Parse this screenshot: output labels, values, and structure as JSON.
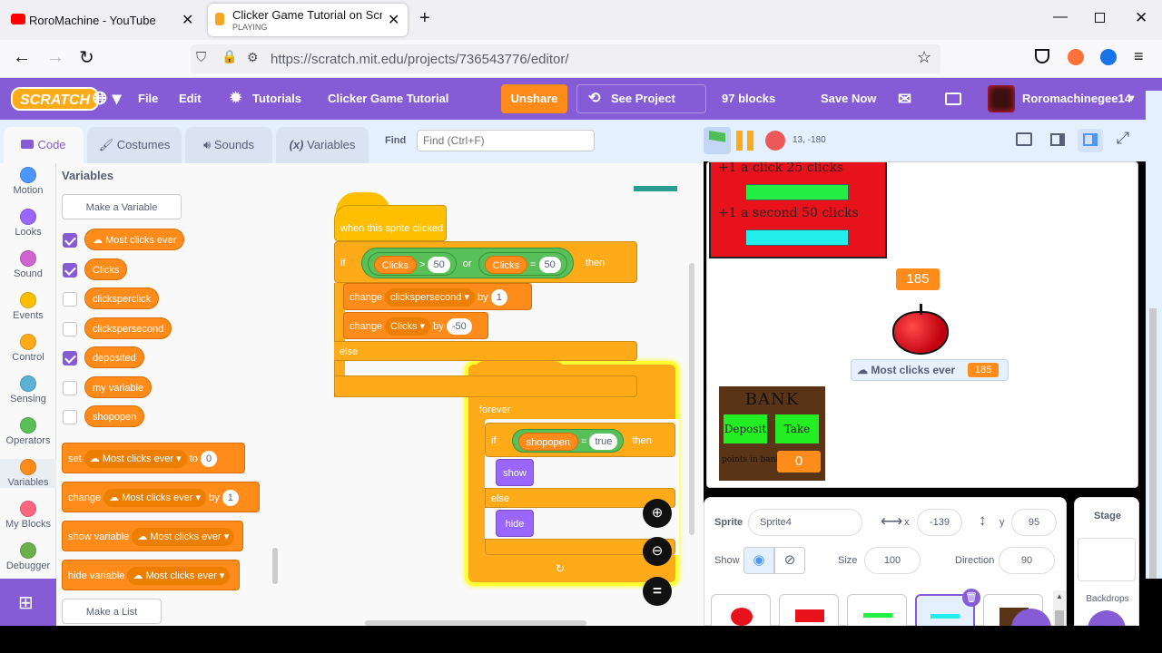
{
  "browser": {
    "tab1_title": "RoroMachine - YouTube",
    "tab2_title": "Clicker Game Tutorial on Scratc",
    "tab2_status": "PLAYING",
    "url": "https://scratch.mit.edu/projects/736543776/editor/"
  },
  "menu": {
    "file": "File",
    "edit": "Edit",
    "tutorials": "Tutorials",
    "project_title": "Clicker Game Tutorial",
    "unshare": "Unshare",
    "see_project": "See Project Page",
    "block_count": "97 blocks",
    "save_now": "Save Now",
    "username": "Roromachinegee14",
    "logo": "SCRATCH"
  },
  "tabs": {
    "code": "Code",
    "costumes": "Costumes",
    "sounds": "Sounds",
    "variables": "Variables",
    "find": "Find",
    "find_placeholder": "Find (Ctrl+F)"
  },
  "categories": [
    {
      "label": "Motion",
      "color": "#4c97ff"
    },
    {
      "label": "Looks",
      "color": "#9966ff"
    },
    {
      "label": "Sound",
      "color": "#cf63cf"
    },
    {
      "label": "Events",
      "color": "#ffbf00"
    },
    {
      "label": "Control",
      "color": "#ffab19"
    },
    {
      "label": "Sensing",
      "color": "#5cb1d6"
    },
    {
      "label": "Operators",
      "color": "#59c059"
    },
    {
      "label": "Variables",
      "color": "#ff8c1a"
    },
    {
      "label": "My Blocks",
      "color": "#ff6680"
    },
    {
      "label": "Debugger",
      "color": "#6ab04c"
    }
  ],
  "palette": {
    "heading": "Variables",
    "make_variable": "Make a Variable",
    "variables": [
      {
        "name": "Most clicks ever",
        "checked": true
      },
      {
        "name": "Clicks",
        "checked": true
      },
      {
        "name": "clicksperclick",
        "checked": false
      },
      {
        "name": "clickspersecond",
        "checked": false
      },
      {
        "name": "deposited",
        "checked": true
      },
      {
        "name": "my variable",
        "checked": false
      },
      {
        "name": "shopopen",
        "checked": false
      }
    ],
    "set_label": "set",
    "set_var": "Most clicks ever",
    "set_to": "to",
    "set_value": "0",
    "change_label": "change",
    "change_var": "Most clicks ever",
    "change_by": "by",
    "change_value": "1",
    "show_label": "show variable",
    "show_var": "Most clicks ever",
    "hide_label": "hide variable",
    "hide_var": "Most clicks ever",
    "make_list": "Make a List"
  },
  "script1": {
    "hat": "when this sprite clicked",
    "if": "if",
    "clicks1": "Clicks",
    "gt": ">",
    "v50a": "50",
    "or": "or",
    "clicks2": "Clicks",
    "eq": "=",
    "v50b": "50",
    "then": "then",
    "change1": "change",
    "change1_var": "clickspersecond",
    "by1": "by",
    "change1_val": "1",
    "change2": "change",
    "change2_var": "Clicks",
    "by2": "by",
    "change2_val": "-50",
    "else": "else"
  },
  "script2": {
    "forever": "forever",
    "if": "if",
    "var": "shopopen",
    "eq": "=",
    "val": "true",
    "then": "then",
    "show": "show",
    "else": "else",
    "hide": "hide"
  },
  "stage_header": {
    "coords": "13, -180"
  },
  "stage": {
    "shop_line1": "+1 a click  25 clicks",
    "shop_line2": "+1 a second 50 clicks",
    "clicks_value": "185",
    "monitor_label": "Most clicks ever",
    "monitor_value": "185",
    "bank_title": "BANK",
    "deposit": "Deposit",
    "take": "Take",
    "points_label": "points in bank",
    "bank_value": "0"
  },
  "sprite_info": {
    "sprite_label": "Sprite",
    "sprite_name": "Sprite4",
    "x_label": "x",
    "x": "-139",
    "y_label": "y",
    "y": "95",
    "show_label": "Show",
    "size_label": "Size",
    "size": "100",
    "direction_label": "Direction",
    "direction": "90"
  },
  "stage_pane": {
    "title": "Stage",
    "backdrops": "Backdrops"
  }
}
